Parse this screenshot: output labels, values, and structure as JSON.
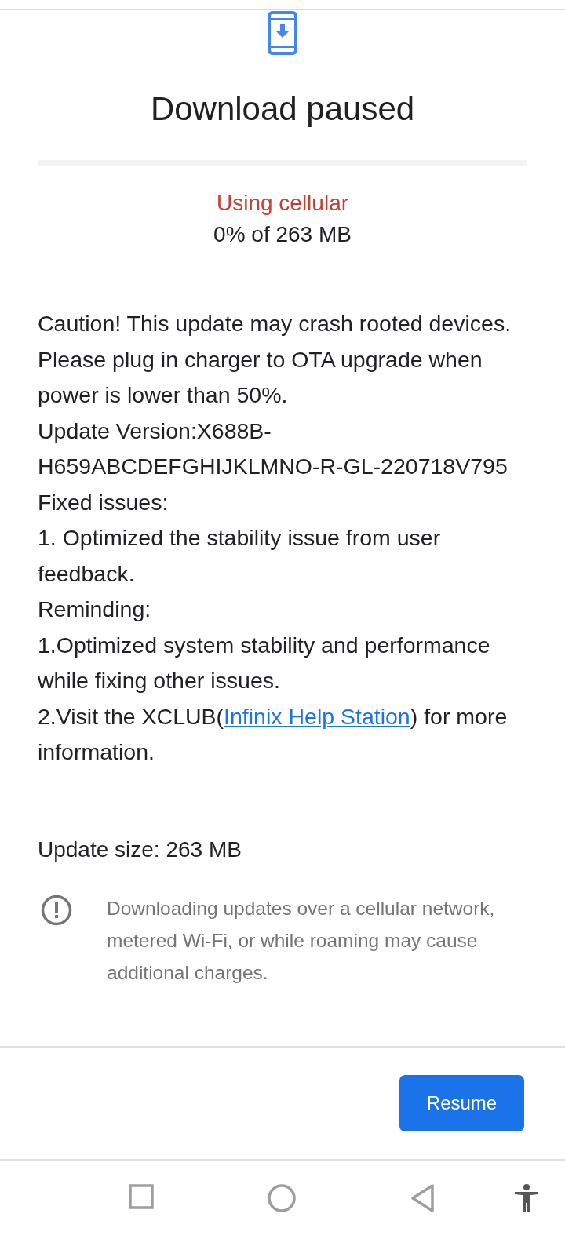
{
  "title": "Download paused",
  "progress": {
    "level": 0
  },
  "network_status": "Using cellular",
  "progress_text": "0% of 263 MB",
  "details": [
    {
      "kind": "text",
      "text": "Caution! This update may crash rooted devices."
    },
    {
      "kind": "text",
      "text": "Please plug in charger to OTA upgrade when power is lower than 50%."
    },
    {
      "kind": "text",
      "text": "Update Version:X688B-H659ABCDEFGHIJKLMNO-R-GL-220718V795"
    },
    {
      "kind": "text",
      "text": "Fixed issues:"
    },
    {
      "kind": "text",
      "text": "1. Optimized the stability issue from user feedback."
    },
    {
      "kind": "text",
      "text": "Reminding:"
    },
    {
      "kind": "text",
      "text": "1.Optimized system stability and performance while fixing other issues."
    },
    {
      "kind": "link",
      "before": "2.Visit the XCLUB(",
      "link": "Infinix Help Station",
      "after": ") for more information."
    }
  ],
  "update_size": "Update size: 263 MB",
  "notice": "Downloading updates over a cellular network, metered Wi-Fi, or while roaming may cause additional charges.",
  "button": "Resume"
}
